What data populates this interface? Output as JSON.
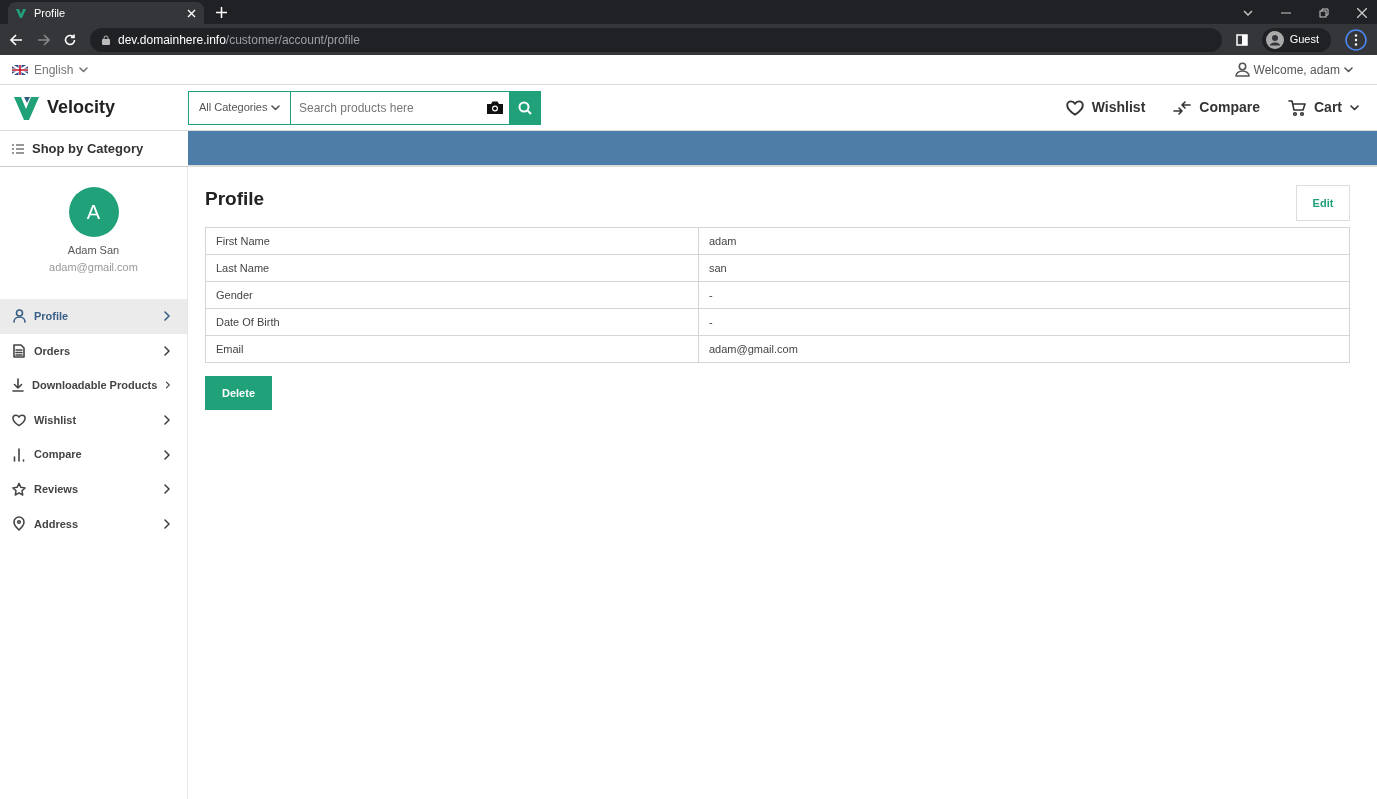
{
  "browser": {
    "tab_title": "Profile",
    "url_host": "dev.domainhere.info",
    "url_path": "/customer/account/profile",
    "profile": "Guest"
  },
  "top_bar": {
    "language": "English",
    "welcome": "Welcome, adam"
  },
  "header": {
    "logo": "Velocity",
    "category_select": "All Categories",
    "search": {
      "placeholder": "Search products here"
    },
    "links": [
      "Wishlist",
      "Compare",
      "Cart"
    ]
  },
  "shop_by_category": "Shop by Category",
  "user": {
    "initial": "A",
    "name": "Adam San",
    "email": "adam@gmail.com"
  },
  "sidebar": {
    "items": [
      {
        "label": "Profile",
        "selected": true
      },
      {
        "label": "Orders",
        "selected": false
      },
      {
        "label": "Downloadable Products",
        "selected": false
      },
      {
        "label": "Wishlist",
        "selected": false
      },
      {
        "label": "Compare",
        "selected": false
      },
      {
        "label": "Reviews",
        "selected": false
      },
      {
        "label": "Address",
        "selected": false
      }
    ]
  },
  "page_title": "Profile",
  "edit_button": "Edit",
  "table": {
    "rows": [
      {
        "label": "First Name",
        "value": "adam"
      },
      {
        "label": "Last Name",
        "value": "san"
      },
      {
        "label": "Gender",
        "value": "-"
      },
      {
        "label": "Date Of Birth",
        "value": "-"
      },
      {
        "label": "Email",
        "value": "adam@gmail.com"
      }
    ]
  },
  "delete_button": "Delete"
}
